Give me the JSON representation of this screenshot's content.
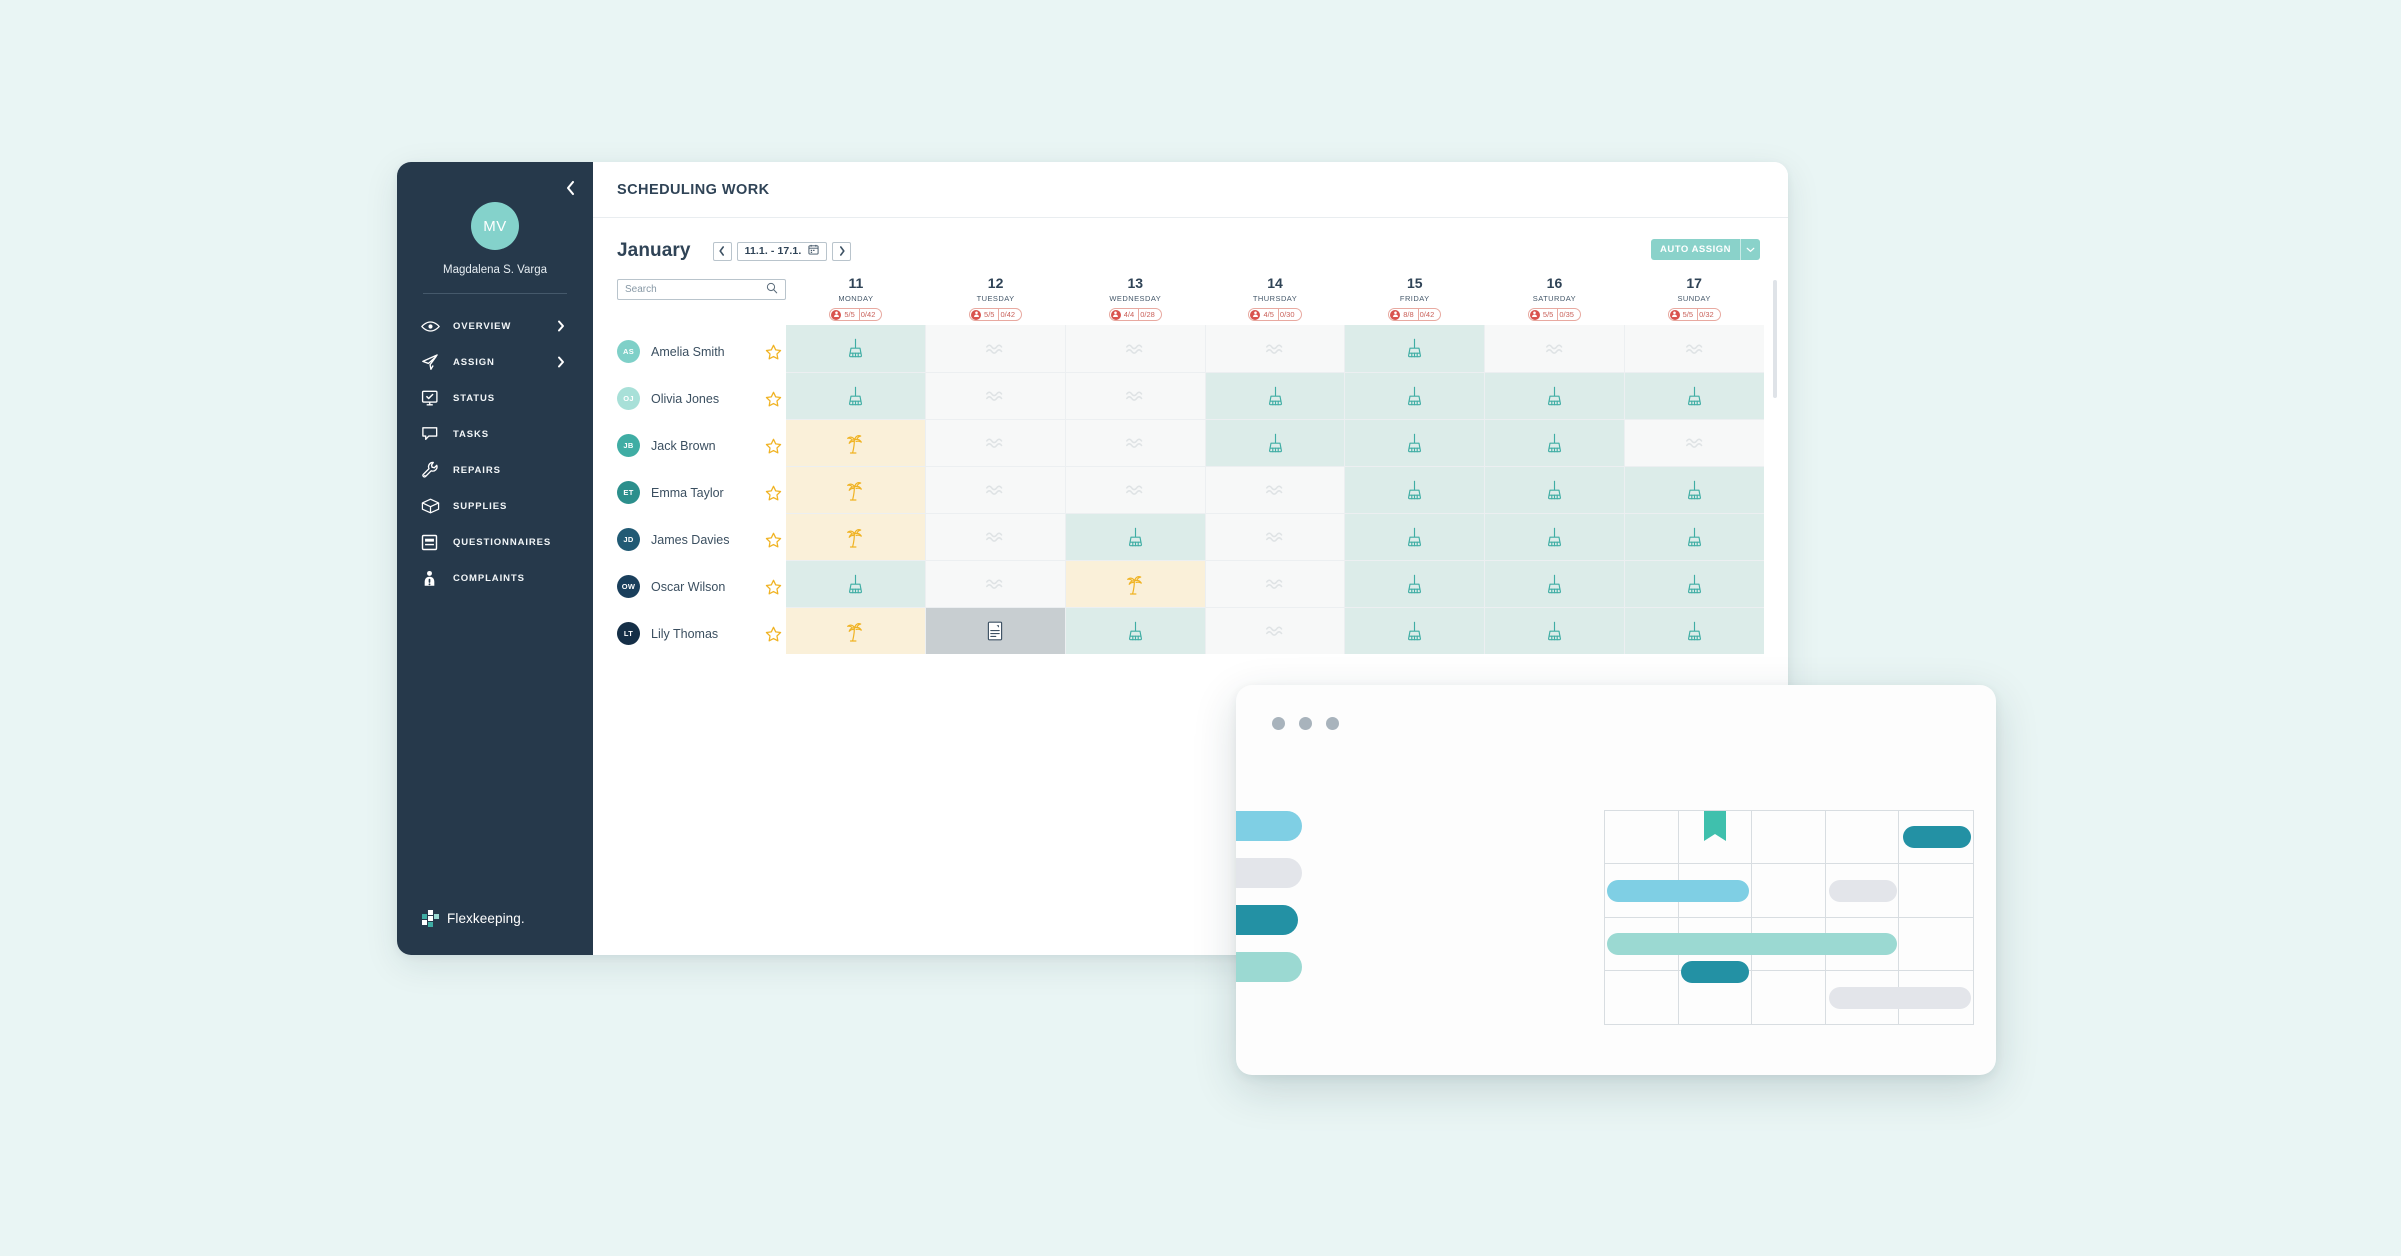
{
  "app": {
    "page_title": "SCHEDULING WORK",
    "collapse_icon": "chevron-left-icon"
  },
  "sidebar": {
    "avatar_initials": "MV",
    "user_name": "Magdalena S. Varga",
    "logo_text": "Flexkeeping.",
    "items": [
      {
        "label": "OVERVIEW",
        "icon": "eye-icon",
        "has_chevron": true
      },
      {
        "label": "ASSIGN",
        "icon": "paper-plane-icon",
        "has_chevron": true
      },
      {
        "label": "STATUS",
        "icon": "monitor-check-icon",
        "has_chevron": false
      },
      {
        "label": "TASKS",
        "icon": "chat-bubble-icon",
        "has_chevron": false
      },
      {
        "label": "REPAIRS",
        "icon": "wrench-icon",
        "has_chevron": false
      },
      {
        "label": "SUPPLIES",
        "icon": "box-icon",
        "has_chevron": false
      },
      {
        "label": "QUESTIONNAIRES",
        "icon": "form-icon",
        "has_chevron": false
      },
      {
        "label": "COMPLAINTS",
        "icon": "person-alert-icon",
        "has_chevron": false
      }
    ]
  },
  "toolbar": {
    "month": "January",
    "prev_label": "‹",
    "next_label": "›",
    "date_range": "11.1. - 17.1.",
    "calendar_icon": "calendar-icon",
    "auto_assign_label": "AUTO ASSIGN",
    "auto_assign_caret": "chevron-down-icon"
  },
  "search": {
    "placeholder": "Search",
    "value": "",
    "icon": "search-icon"
  },
  "people": [
    {
      "initials": "AS",
      "name": "Amelia Smith",
      "color": "#7fd0c8",
      "starred": false
    },
    {
      "initials": "OJ",
      "name": "Olivia Jones",
      "color": "#a8e0d8",
      "starred": false
    },
    {
      "initials": "JB",
      "name": "Jack Brown",
      "color": "#3fada4",
      "starred": false
    },
    {
      "initials": "ET",
      "name": "Emma Taylor",
      "color": "#2c8f8c",
      "starred": false
    },
    {
      "initials": "JD",
      "name": "James Davies",
      "color": "#215a74",
      "starred": false
    },
    {
      "initials": "OW",
      "name": "Oscar Wilson",
      "color": "#1a3f5c",
      "starred": false
    },
    {
      "initials": "LT",
      "name": "Lily Thomas",
      "color": "#152f47",
      "starred": false
    }
  ],
  "days": [
    {
      "num": "11",
      "name": "MONDAY",
      "staff": "5/5",
      "rooms": "0/42"
    },
    {
      "num": "12",
      "name": "TUESDAY",
      "staff": "5/5",
      "rooms": "0/42"
    },
    {
      "num": "13",
      "name": "WEDNESDAY",
      "staff": "4/4",
      "rooms": "0/28"
    },
    {
      "num": "14",
      "name": "THURSDAY",
      "staff": "4/5",
      "rooms": "0/30"
    },
    {
      "num": "15",
      "name": "FRIDAY",
      "staff": "8/8",
      "rooms": "0/42"
    },
    {
      "num": "16",
      "name": "SATURDAY",
      "staff": "5/5",
      "rooms": "0/35"
    },
    {
      "num": "17",
      "name": "SUNDAY",
      "staff": "5/5",
      "rooms": "0/32"
    }
  ],
  "schedule": {
    "legend": {
      "work": "broom-icon",
      "off": "wave-icon",
      "vacation": "palm-tree-icon",
      "note": "note-icon"
    },
    "rows": [
      {
        "person": "Amelia Smith",
        "cells": [
          "work",
          "off",
          "off",
          "off",
          "work",
          "off",
          "off"
        ]
      },
      {
        "person": "Olivia Jones",
        "cells": [
          "work",
          "off",
          "off",
          "work",
          "work",
          "work",
          "work"
        ]
      },
      {
        "person": "Jack Brown",
        "cells": [
          "vac",
          "off",
          "off",
          "work",
          "work",
          "work",
          "off"
        ]
      },
      {
        "person": "Emma Taylor",
        "cells": [
          "vac",
          "off",
          "off",
          "off",
          "work",
          "work",
          "work"
        ]
      },
      {
        "person": "James Davies",
        "cells": [
          "vac",
          "off",
          "work",
          "off",
          "work",
          "work",
          "work"
        ]
      },
      {
        "person": "Oscar Wilson",
        "cells": [
          "work",
          "off",
          "vac",
          "off",
          "work",
          "work",
          "work"
        ]
      },
      {
        "person": "Lily Thomas",
        "cells": [
          "vac",
          "note",
          "work",
          "off",
          "work",
          "work",
          "work"
        ]
      }
    ]
  },
  "floating_window": {
    "dots": [
      "red-dot",
      "yellow-dot",
      "green-dot"
    ],
    "side_chips": [
      {
        "color": "#7fcfe4"
      },
      {
        "color": "#e3e5ea"
      },
      {
        "color": "#2391a4"
      },
      {
        "color": "#9bd9d2"
      }
    ],
    "bars": [
      {
        "color": "#2391a4",
        "row": 1,
        "col_start": 5,
        "col_span": 1
      },
      {
        "color": "#7fcfe4",
        "row": 2,
        "col_start": 1,
        "col_span": 2
      },
      {
        "color": "#e3e5ea",
        "row": 2,
        "col_start": 4,
        "col_span": 1
      },
      {
        "color": "#9bd9d2",
        "row": 3,
        "col_start": 1,
        "col_span": 4
      },
      {
        "color": "#2391a4",
        "row": 3,
        "col_start": 2,
        "col_span": 1
      },
      {
        "color": "#e3e5ea",
        "row": 4,
        "col_start": 4,
        "col_span": 2
      }
    ],
    "flag": {
      "color": "#3fc0ad",
      "row": 1,
      "col": 2
    }
  },
  "colors": {
    "background": "#e9f5f4",
    "sidebar": "#26394b",
    "accent_teal": "#8ad2ca",
    "work_cell": "#dcece9",
    "vacation_cell": "#faf0d9",
    "off_cell": "#f7f8f8",
    "note_cell": "#c8ced1",
    "badge_red": "#d9534f",
    "star_yellow": "#f0b323"
  }
}
